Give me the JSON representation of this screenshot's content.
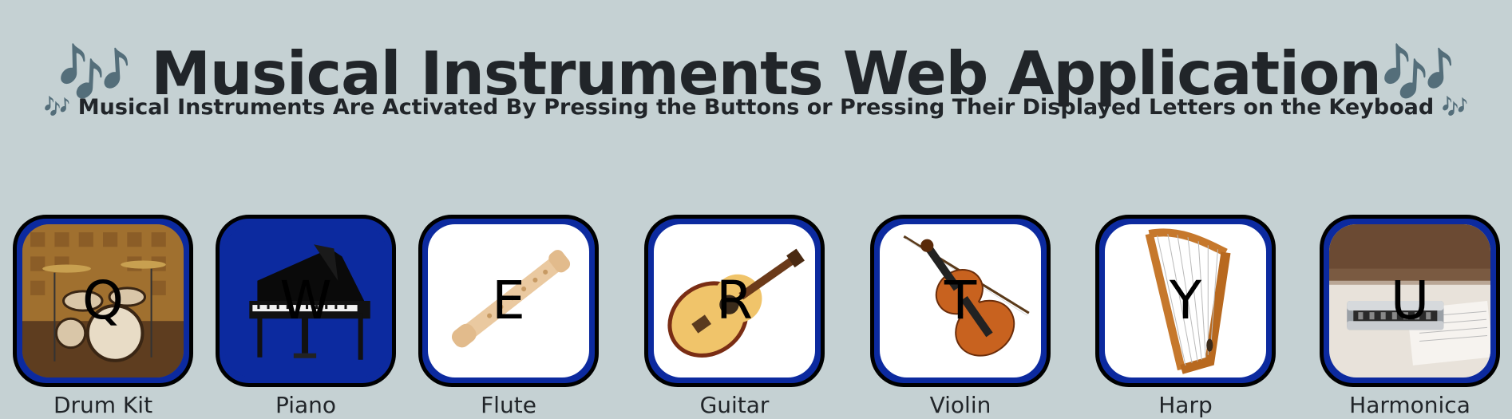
{
  "header": {
    "title": "Musical Instruments Web Application",
    "subtitle": "Musical Instruments Are Activated By Pressing the Buttons or Pressing Their Displayed Letters on the Keyboad",
    "note_glyph": "🎶"
  },
  "instruments": [
    {
      "key": "Q",
      "name": "Drum Kit"
    },
    {
      "key": "W",
      "name": "Piano"
    },
    {
      "key": "E",
      "name": "Flute"
    },
    {
      "key": "R",
      "name": "Guitar"
    },
    {
      "key": "T",
      "name": "Violin"
    },
    {
      "key": "Y",
      "name": "Harp"
    },
    {
      "key": "U",
      "name": "Harmonica"
    }
  ],
  "colors": {
    "background": "#c5d1d3",
    "tile_frame": "#0c2a9f",
    "tile_border": "#000000",
    "text": "#212529",
    "note": "#2a98d9"
  }
}
